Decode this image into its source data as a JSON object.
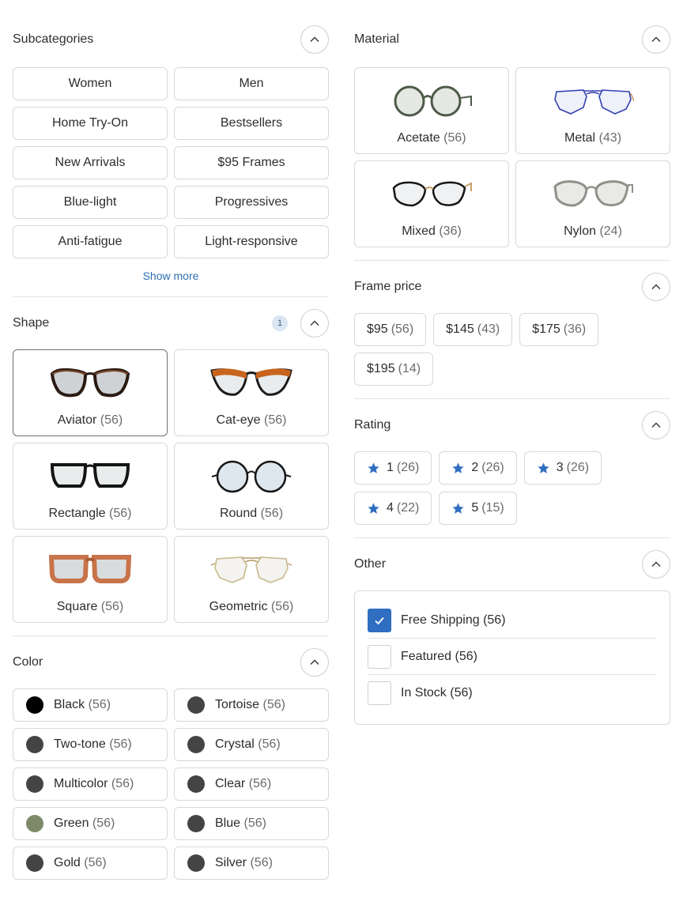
{
  "subcategories": {
    "title": "Subcategories",
    "items": [
      "Women",
      "Men",
      "Home Try-On",
      "Bestsellers",
      "New Arrivals",
      "$95 Frames",
      "Blue-light",
      "Progressives",
      "Anti-fatigue",
      "Light-responsive"
    ],
    "show_more": "Show more"
  },
  "shape": {
    "title": "Shape",
    "badge": "1",
    "items": [
      {
        "label": "Aviator",
        "count": "(56)",
        "icon": "cat-eye-dark-glasses-icon",
        "selected": true
      },
      {
        "label": "Cat-eye",
        "count": "(56)",
        "icon": "cat-eye-orange-glasses-icon"
      },
      {
        "label": "Rectangle",
        "count": "(56)",
        "icon": "rectangle-glasses-icon"
      },
      {
        "label": "Round",
        "count": "(56)",
        "icon": "round-glasses-icon"
      },
      {
        "label": "Square",
        "count": "(56)",
        "icon": "square-tortoise-glasses-icon"
      },
      {
        "label": "Geometric",
        "count": "(56)",
        "icon": "geometric-glasses-icon"
      }
    ]
  },
  "color": {
    "title": "Color",
    "items": [
      {
        "label": "Black",
        "count": "(56)",
        "swatch": "#000000"
      },
      {
        "label": "Tortoise",
        "count": "(56)",
        "swatch": "#444444"
      },
      {
        "label": "Two-tone",
        "count": "(56)",
        "swatch": "#444444"
      },
      {
        "label": "Crystal",
        "count": "(56)",
        "swatch": "#444444"
      },
      {
        "label": "Multicolor",
        "count": "(56)",
        "swatch": "#444444"
      },
      {
        "label": "Clear",
        "count": "(56)",
        "swatch": "#444444"
      },
      {
        "label": "Green",
        "count": "(56)",
        "swatch": "#7c8a6a"
      },
      {
        "label": "Blue",
        "count": "(56)",
        "swatch": "#444444"
      },
      {
        "label": "Gold",
        "count": "(56)",
        "swatch": "#444444"
      },
      {
        "label": "Silver",
        "count": "(56)",
        "swatch": "#444444"
      }
    ]
  },
  "material": {
    "title": "Material",
    "items": [
      {
        "label": "Acetate",
        "count": "(56)",
        "icon": "acetate-glasses-icon"
      },
      {
        "label": "Metal",
        "count": "(43)",
        "icon": "metal-glasses-icon"
      },
      {
        "label": "Mixed",
        "count": "(36)",
        "icon": "mixed-glasses-icon"
      },
      {
        "label": "Nylon",
        "count": "(24)",
        "icon": "nylon-glasses-icon"
      }
    ]
  },
  "frame_price": {
    "title": "Frame price",
    "items": [
      {
        "label": "$95",
        "count": "(56)"
      },
      {
        "label": "$145",
        "count": "(43)"
      },
      {
        "label": "$175",
        "count": "(36)"
      },
      {
        "label": "$195",
        "count": "(14)"
      }
    ]
  },
  "rating": {
    "title": "Rating",
    "items": [
      {
        "label": "1",
        "count": "(26)"
      },
      {
        "label": "2",
        "count": "(26)"
      },
      {
        "label": "3",
        "count": "(26)"
      },
      {
        "label": "4",
        "count": "(22)"
      },
      {
        "label": "5",
        "count": "(15)"
      }
    ]
  },
  "other": {
    "title": "Other",
    "items": [
      {
        "label": "Free Shipping (56)",
        "checked": true
      },
      {
        "label": "Featured (56)",
        "checked": false
      },
      {
        "label": "In Stock (56)",
        "checked": false
      }
    ]
  },
  "colors": {
    "accent": "#2f6ec0",
    "link": "#2d6fb3",
    "star": "#2f6ec0"
  }
}
